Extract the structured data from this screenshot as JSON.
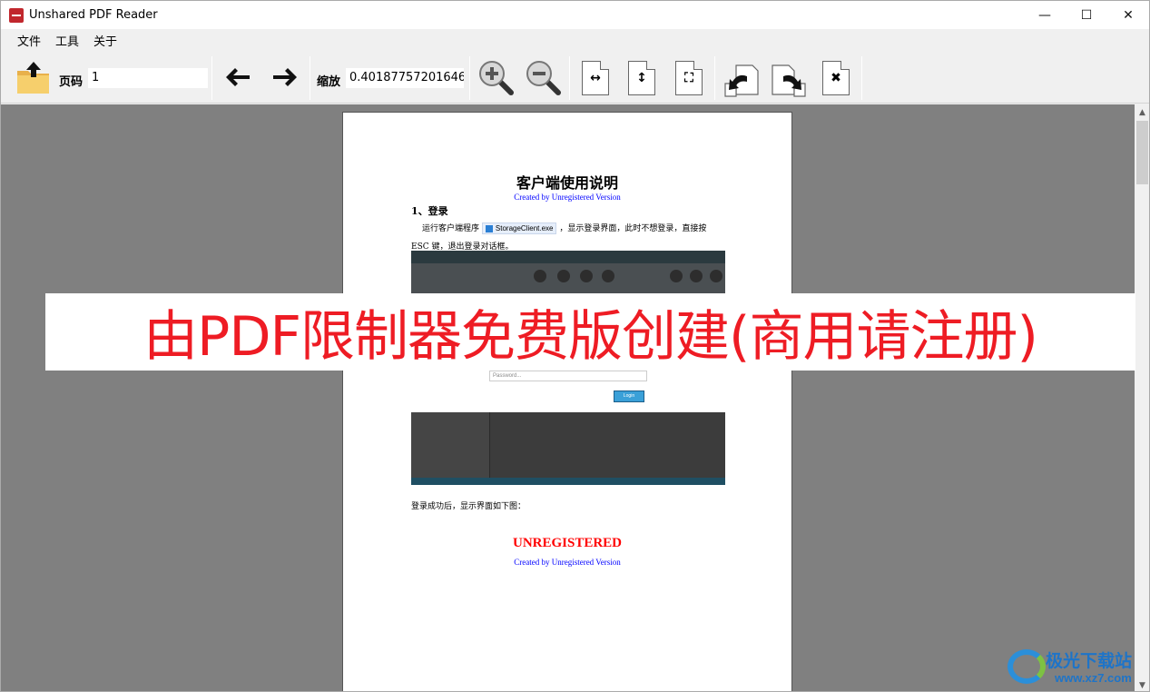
{
  "window": {
    "title": "Unshared PDF Reader",
    "minimize_glyph": "—",
    "maximize_glyph": "☐",
    "close_glyph": "✕"
  },
  "menu": [
    "文件",
    "工具",
    "关于"
  ],
  "toolbar": {
    "page_label": "页码",
    "page_value": "1",
    "zoom_label": "缩放",
    "zoom_value": "0.40187757201646",
    "prev_glyph": "🡐",
    "next_glyph": "🡒",
    "fit_width_glyph": "↔",
    "fit_height_glyph": "↕",
    "fullscreen_glyph": "⛶",
    "rotate_left_glyph": "↶",
    "rotate_right_glyph": "↷",
    "close_doc_glyph": "✖"
  },
  "document": {
    "title": "客户端使用说明",
    "section_heading": "1、登录",
    "para1_before": "运行客户端程序",
    "exe_name": "StorageClient.exe",
    "para1_after": "，显示登录界面，此时不想登录，直接按",
    "para2": "ESC 键，退出登录对话框。",
    "password_placeholder": "Password...",
    "login_button": "Login",
    "para3": "登录成功后，显示界面如下图：",
    "watermark_created": "Created by Unregistered Version",
    "watermark_unregistered": "UNREGISTERED"
  },
  "overlay_watermark": "由PDF限制器免费版创建(商用请注册)",
  "site_logo": {
    "name": "极光下载站",
    "url": "www.xz7.com"
  },
  "colors": {
    "overlay_red": "#ee1c24",
    "viewer_background": "#808080",
    "watermark_blue": "#0000ff",
    "watermark_red": "#ff0000"
  }
}
